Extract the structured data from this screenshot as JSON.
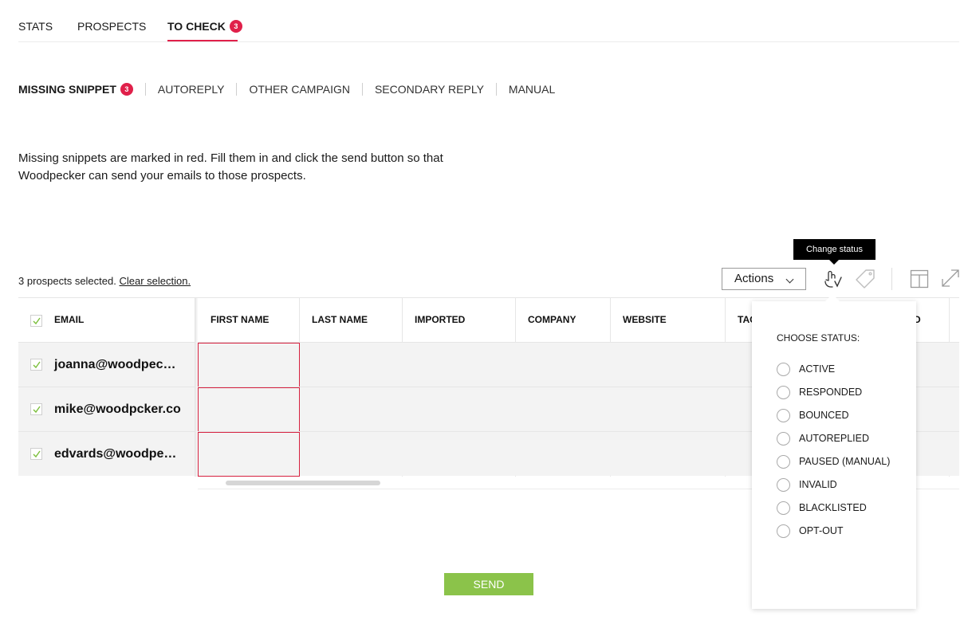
{
  "top_tabs": [
    {
      "label": "STATS"
    },
    {
      "label": "PROSPECTS"
    },
    {
      "label": "TO CHECK",
      "badge": "3"
    }
  ],
  "sub_tabs": [
    {
      "label": "MISSING SNIPPET",
      "badge": "3"
    },
    {
      "label": "AUTOREPLY"
    },
    {
      "label": "OTHER CAMPAIGN"
    },
    {
      "label": "SECONDARY REPLY"
    },
    {
      "label": "MANUAL"
    }
  ],
  "description": "Missing snippets are marked in red. Fill them in and click the send button so that Woodpecker can send your emails to those prospects.",
  "selection": {
    "text": "3 prospects selected.",
    "clear_link": "Clear selection."
  },
  "toolbar": {
    "actions_label": "Actions",
    "tooltip": "Change status"
  },
  "table": {
    "headers": [
      "EMAIL",
      "FIRST NAME",
      "LAST NAME",
      "IMPORTED",
      "COMPANY",
      "WEBSITE",
      "TAG",
      "D"
    ],
    "rows": [
      {
        "email": "joanna@woodpec…"
      },
      {
        "email": "mike@woodpcker.co"
      },
      {
        "email": "edvards@woodpe…"
      }
    ]
  },
  "send_label": "SEND",
  "status_menu": {
    "title": "CHOOSE STATUS:",
    "options": [
      "ACTIVE",
      "RESPONDED",
      "BOUNCED",
      "AUTOREPLIED",
      "PAUSED (MANUAL)",
      "INVALID",
      "BLACKLISTED",
      "OPT-OUT"
    ]
  },
  "colors": {
    "accent_red": "#e0204a",
    "send_green": "#8bc34a",
    "check_green": "#7cbf3c"
  },
  "icons": [
    "change-status-icon",
    "tag-icon",
    "columns-icon",
    "expand-icon",
    "check-icon",
    "chevron-down-icon"
  ]
}
